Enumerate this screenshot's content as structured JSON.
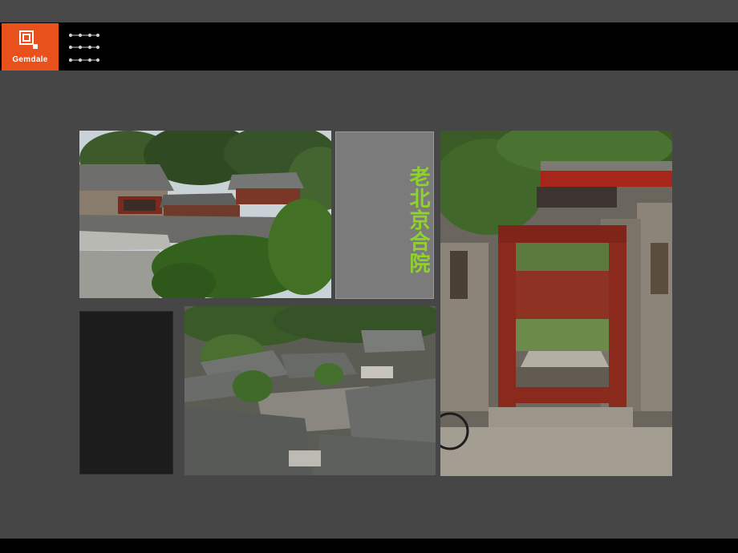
{
  "header": {
    "logo_text": "Gemdale",
    "logo_icon": "gemdale-logo-icon",
    "menu_icon": "dotted-menu-icon"
  },
  "colors": {
    "brand_orange": "#e8501c",
    "background": "#464646",
    "title_green": "#8fd32a",
    "title_panel": "#7b7b7b"
  },
  "main": {
    "title": "老北京合院",
    "images": [
      {
        "name": "courtyard-roofs-photo"
      },
      {
        "name": "courtyard-gate-photo"
      },
      {
        "name": "aerial-courtyard-photo"
      }
    ]
  }
}
